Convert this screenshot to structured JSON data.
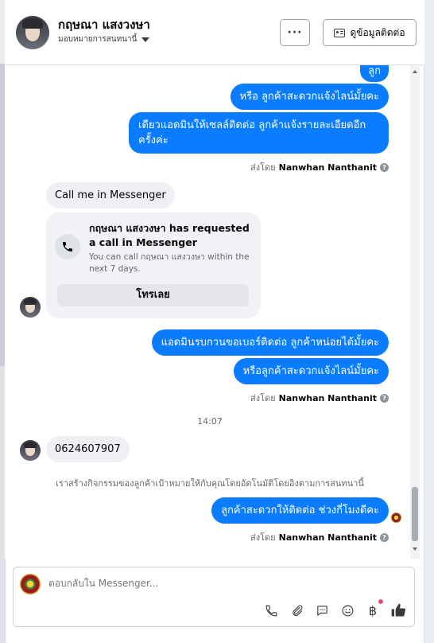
{
  "header": {
    "contact_name": "กฤษณา แสงวงษา",
    "assign_label": "มอบหมายการสนทนานี้",
    "more_label": "···",
    "contact_info_label": "ดูข้อมูลติดต่อ"
  },
  "messages": {
    "partial_top": "ลูก",
    "out1": "หรือ ลูกค้าสะดวกแจ้งไลน์มั้ยคะ",
    "out2_line1": "เดียวแอดมินให้เซลล์ติดต่อ ลูกค้าแจ้งรายละเอียดอีก",
    "out2_line2": "ครั้งค่ะ",
    "sent_by_prefix": "ส่งโดย",
    "sent_by_name": "Nanwhan Nanthanit",
    "in1": "Call me in Messenger",
    "call_card": {
      "title_name": "กฤษณา แสงวงษา",
      "title_rest": " has requested a call in Messenger",
      "subtitle": "You can call กฤษณา แสงวงษา within the next 7 days.",
      "button": "โทรเลย"
    },
    "out3": "แอดมินรบกวนขอเบอร์ติดต่อ ลูกค้าหน่อยได้มั้ยคะ",
    "out4": "หรือลูกค้าสะดวกแจ้งไลน์มั้ยคะ",
    "time": "14:07",
    "in2": "0624607907",
    "system_note": "เราสร้างกิจกรรมของลูกค้าเป้าหมายให้กับคุณโดยอัตโนมัติโดยอิงตามการสนทนานี้",
    "out5": "ลูกค้าสะดวกให้ติดต่อ ช่วงกี่โมงดีคะ"
  },
  "composer": {
    "placeholder": "ตอบกลับใน Messenger..."
  },
  "icons": [
    "phone-icon",
    "attach-icon",
    "chat-bubble-icon",
    "emoji-icon",
    "baht-icon",
    "like-icon"
  ]
}
